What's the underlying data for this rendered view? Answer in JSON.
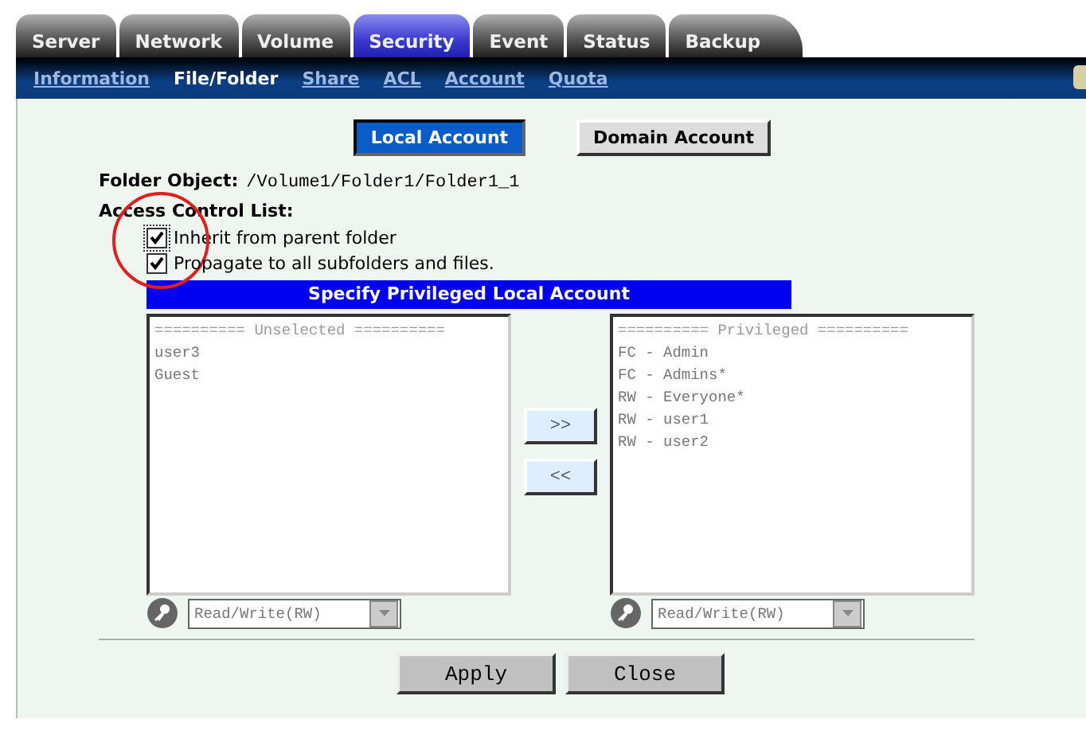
{
  "tabs": [
    {
      "label": "Server",
      "selected": false
    },
    {
      "label": "Network",
      "selected": false
    },
    {
      "label": "Volume",
      "selected": false
    },
    {
      "label": "Security",
      "selected": true
    },
    {
      "label": "Event",
      "selected": false
    },
    {
      "label": "Status",
      "selected": false
    },
    {
      "label": "Backup",
      "selected": false
    }
  ],
  "subnav": [
    {
      "label": "Information",
      "selected": false
    },
    {
      "label": "File/Folder",
      "selected": true
    },
    {
      "label": "Share",
      "selected": false
    },
    {
      "label": "ACL",
      "selected": false
    },
    {
      "label": "Account",
      "selected": false
    },
    {
      "label": "Quota",
      "selected": false
    }
  ],
  "account_type": [
    {
      "label": "Local Account",
      "selected": true
    },
    {
      "label": "Domain Account",
      "selected": false
    }
  ],
  "folder_object": {
    "label": "Folder Object:",
    "value": "/Volume1/Folder1/Folder1_1"
  },
  "acl": {
    "label": "Access Control List:",
    "options": [
      {
        "label": "Inherit from parent folder",
        "checked": true,
        "highlighted": true
      },
      {
        "label": "Propagate to all subfolders and files.",
        "checked": true,
        "highlighted": false
      }
    ]
  },
  "panel_title": "Specify Privileged Local Account",
  "unselected": {
    "header": "========== Unselected ==========",
    "items": [
      "user3",
      "Guest"
    ],
    "permission": {
      "value": "Read/Write(RW)",
      "disabled": true
    }
  },
  "privileged": {
    "header": "========== Privileged ==========",
    "items": [
      "FC - Admin",
      "FC - Admins*",
      "RW - Everyone*",
      "RW - user1",
      "RW - user2"
    ],
    "permission": {
      "value": "Read/Write(RW)",
      "disabled": true
    }
  },
  "move_buttons": [
    ">>",
    "<<"
  ],
  "buttons": [
    "Apply",
    "Close"
  ]
}
